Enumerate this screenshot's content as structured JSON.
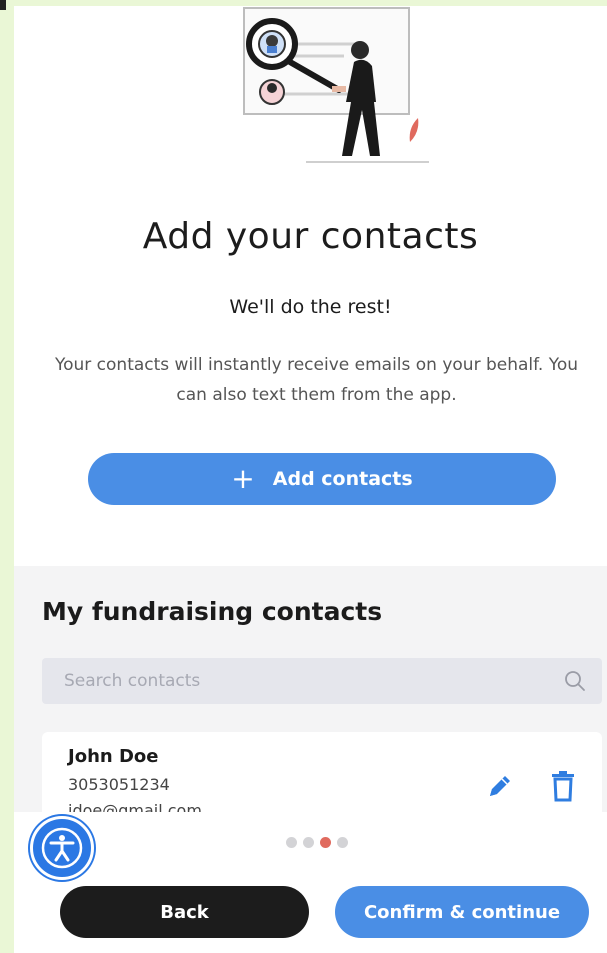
{
  "hero": {
    "illustration": "person-with-magnifying-glass-searching-contacts"
  },
  "heading": {
    "title": "Add your contacts",
    "subtitle": "We'll do the rest!",
    "description": "Your contacts will instantly receive emails on your behalf. You can also text them from the app."
  },
  "add_button": {
    "icon": "plus-icon",
    "label": "Add contacts"
  },
  "contacts": {
    "title": "My fundraising contacts",
    "search": {
      "placeholder": "Search contacts",
      "value": "",
      "icon": "search-icon"
    },
    "items": [
      {
        "name": "John Doe",
        "phone": "3053051234",
        "email": "jdoe@gmail.com",
        "actions": [
          "edit-icon",
          "trash-icon"
        ]
      }
    ]
  },
  "pagination": {
    "total": 4,
    "current": 3
  },
  "footer": {
    "back_label": "Back",
    "confirm_label": "Confirm & continue"
  },
  "accessibility": {
    "icon": "accessibility-icon"
  },
  "colors": {
    "primary": "#4a8ee5",
    "dark_button": "#1c1c1c",
    "active_dot": "#e06a5e",
    "panel_bg": "#f4f4f5",
    "page_bg": "#eaf7d6"
  }
}
